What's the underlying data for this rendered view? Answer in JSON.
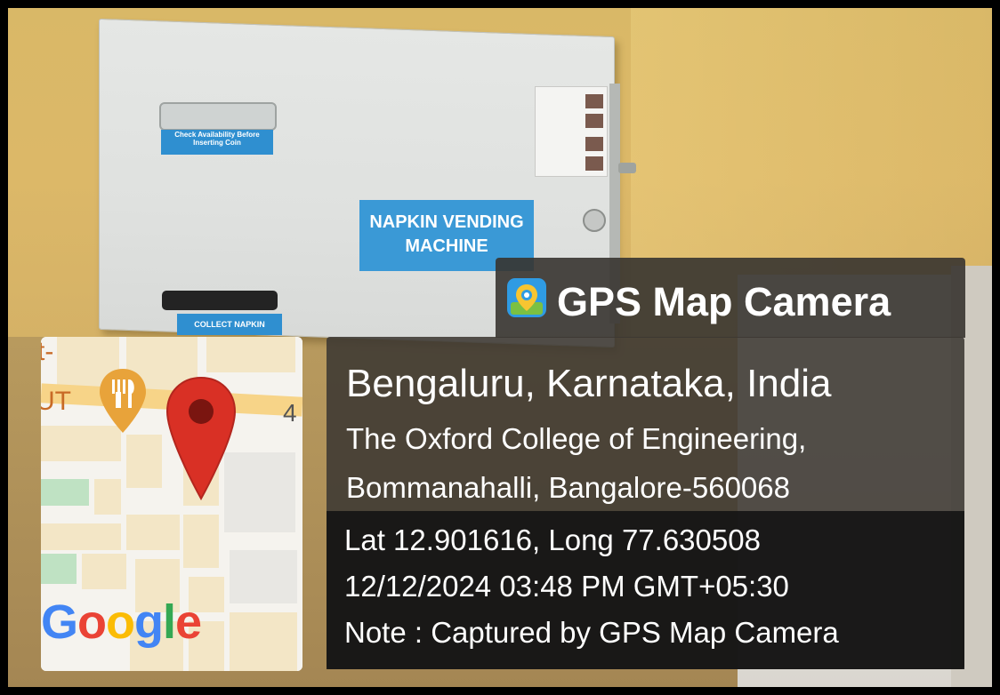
{
  "machine": {
    "check_label": "Check Availability Before Inserting Coin",
    "title_label": "NAPKIN VENDING MACHINE",
    "collect_label": "COLLECT NAPKIN"
  },
  "stamp": {
    "app_name": "GPS Map Camera",
    "location": "Bengaluru, Karnataka, India",
    "address_line1": "The Oxford College of Engineering,",
    "address_line2": "Bommanahalli, Bangalore-560068",
    "coordinates": "Lat 12.901616, Long 77.630508",
    "datetime": "12/12/2024 03:48 PM GMT+05:30",
    "note": "Note : Captured by GPS Map Camera"
  },
  "map": {
    "fragment_top": "t-",
    "fragment_mid": "UT",
    "road_number": "4",
    "brand": "Google",
    "pin_color": "#d93025",
    "food_pin_color": "#e8a33a"
  },
  "icons": [
    "camera-location-icon",
    "map-pin-icon",
    "restaurant-icon"
  ]
}
